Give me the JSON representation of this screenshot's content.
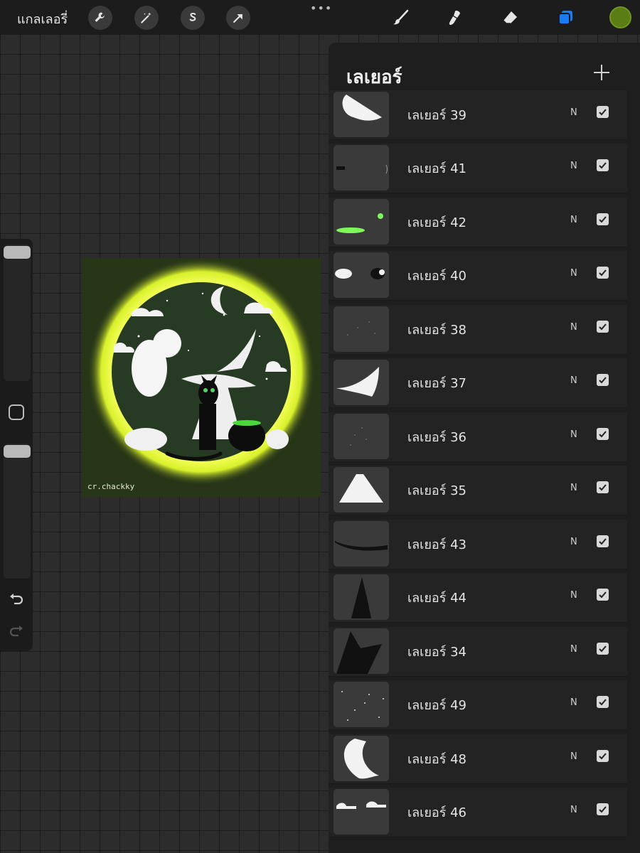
{
  "topbar": {
    "gallery_label": "แกลเลอรี่",
    "more_dots": "•••",
    "tools_left": [
      "wrench-icon",
      "magic-wand-icon",
      "selection-s-icon",
      "transform-arrow-icon"
    ],
    "tools_right": [
      "brush-icon",
      "smudge-icon",
      "eraser-icon",
      "layers-icon"
    ],
    "current_color": "#5b7d16",
    "active_tool_color": "#1a7cf5"
  },
  "artwork": {
    "signature": "cr.chackky"
  },
  "layers": {
    "title": "เลเยอร์",
    "items": [
      {
        "name": "เลเยอร์ 39",
        "blend": "N",
        "visible": true
      },
      {
        "name": "เลเยอร์ 41",
        "blend": "N",
        "visible": true
      },
      {
        "name": "เลเยอร์ 42",
        "blend": "N",
        "visible": true
      },
      {
        "name": "เลเยอร์ 40",
        "blend": "N",
        "visible": true
      },
      {
        "name": "เลเยอร์ 38",
        "blend": "N",
        "visible": true
      },
      {
        "name": "เลเยอร์ 37",
        "blend": "N",
        "visible": true
      },
      {
        "name": "เลเยอร์ 36",
        "blend": "N",
        "visible": true
      },
      {
        "name": "เลเยอร์ 35",
        "blend": "N",
        "visible": true
      },
      {
        "name": "เลเยอร์ 43",
        "blend": "N",
        "visible": true
      },
      {
        "name": "เลเยอร์ 44",
        "blend": "N",
        "visible": true
      },
      {
        "name": "เลเยอร์ 34",
        "blend": "N",
        "visible": true
      },
      {
        "name": "เลเยอร์ 49",
        "blend": "N",
        "visible": true
      },
      {
        "name": "เลเยอร์ 48",
        "blend": "N",
        "visible": true
      },
      {
        "name": "เลเยอร์ 46",
        "blend": "N",
        "visible": true
      }
    ]
  }
}
